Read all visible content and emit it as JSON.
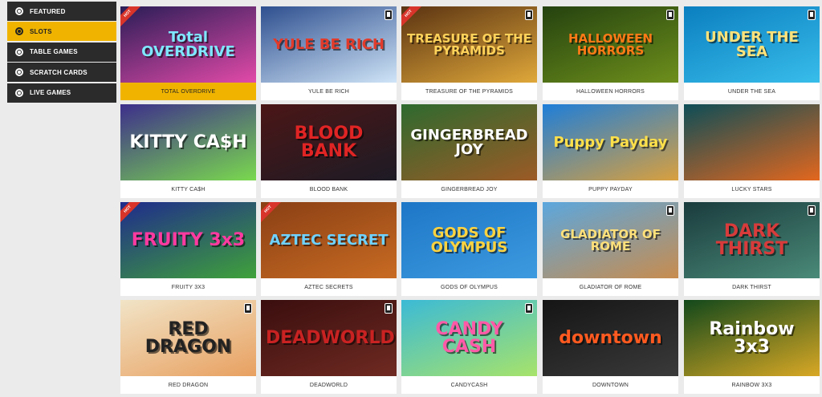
{
  "sidebar": {
    "items": [
      {
        "label": "FEATURED",
        "active": false
      },
      {
        "label": "SLOTS",
        "active": true
      },
      {
        "label": "TABLE GAMES",
        "active": false
      },
      {
        "label": "SCRATCH CARDS",
        "active": false
      },
      {
        "label": "LIVE GAMES",
        "active": false
      }
    ]
  },
  "games": [
    {
      "name": "TOTAL OVERDRIVE",
      "art_text": "Total OVERDRIVE",
      "hot": true,
      "mobile": false,
      "selected": true,
      "bg": [
        "#2a1d57",
        "#e24aa8"
      ],
      "fg": "#7fe7ff"
    },
    {
      "name": "YULE BE RICH",
      "art_text": "YULE BE RICH",
      "hot": false,
      "mobile": true,
      "selected": false,
      "bg": [
        "#2e4f8f",
        "#cfe4f7"
      ],
      "fg": "#e23b2b"
    },
    {
      "name": "TREASURE OF THE PYRAMIDS",
      "art_text": "TREASURE OF THE PYRAMIDS",
      "hot": true,
      "mobile": true,
      "selected": false,
      "bg": [
        "#5a3312",
        "#e0a83a"
      ],
      "fg": "#ffd25a"
    },
    {
      "name": "HALLOWEEN HORRORS",
      "art_text": "HALLOWEEN HORRORS",
      "hot": false,
      "mobile": true,
      "selected": false,
      "bg": [
        "#24420f",
        "#6e8f1c"
      ],
      "fg": "#ff7a16"
    },
    {
      "name": "UNDER THE SEA",
      "art_text": "UNDER THE SEA",
      "hot": false,
      "mobile": true,
      "selected": false,
      "bg": [
        "#0b7fc0",
        "#38bdea"
      ],
      "fg": "#ffe27a"
    },
    {
      "name": "KITTY CA$H",
      "art_text": "KITTY CA$H",
      "hot": false,
      "mobile": false,
      "selected": false,
      "bg": [
        "#3d2e8c",
        "#7ad94e"
      ],
      "fg": "#ffffff"
    },
    {
      "name": "BLOOD BANK",
      "art_text": "BLOOD BANK",
      "hot": false,
      "mobile": false,
      "selected": false,
      "bg": [
        "#4b1616",
        "#1d1b25"
      ],
      "fg": "#e02424"
    },
    {
      "name": "GINGERBREAD JOY",
      "art_text": "GINGERBREAD JOY",
      "hot": false,
      "mobile": false,
      "selected": false,
      "bg": [
        "#2e6a2f",
        "#9c5a26"
      ],
      "fg": "#ffffff"
    },
    {
      "name": "PUPPY PAYDAY",
      "art_text": "Puppy Payday",
      "hot": false,
      "mobile": false,
      "selected": false,
      "bg": [
        "#1e7ed9",
        "#d9a03e"
      ],
      "fg": "#ffe04a"
    },
    {
      "name": "LUCKY STARS",
      "art_text": "",
      "hot": false,
      "mobile": false,
      "selected": false,
      "bg": [
        "#0d4d57",
        "#e3671e"
      ],
      "fg": "#ffffff"
    },
    {
      "name": "FRUITY 3X3",
      "art_text": "FRUITY 3x3",
      "hot": true,
      "mobile": false,
      "selected": false,
      "bg": [
        "#1f2b8c",
        "#3fa23a"
      ],
      "fg": "#ff3aa0"
    },
    {
      "name": "AZTEC SECRETS",
      "art_text": "AZTEC SECRET",
      "hot": true,
      "mobile": false,
      "selected": false,
      "bg": [
        "#8a3f14",
        "#c86b23"
      ],
      "fg": "#6fd2ff"
    },
    {
      "name": "GODS OF OLYMPUS",
      "art_text": "GODS OF OLYMPUS",
      "hot": false,
      "mobile": false,
      "selected": false,
      "bg": [
        "#1e77c7",
        "#3d9adf"
      ],
      "fg": "#ffd33f"
    },
    {
      "name": "GLADIATOR OF ROME",
      "art_text": "GLADIATOR OF ROME",
      "hot": false,
      "mobile": true,
      "selected": false,
      "bg": [
        "#5ba7de",
        "#c88c4e"
      ],
      "fg": "#ffe07a"
    },
    {
      "name": "DARK THIRST",
      "art_text": "DARK THIRST",
      "hot": false,
      "mobile": true,
      "selected": false,
      "bg": [
        "#1a3b3d",
        "#4a8a78"
      ],
      "fg": "#d83b3b"
    },
    {
      "name": "RED DRAGON",
      "art_text": "RED DRAGON",
      "hot": false,
      "mobile": true,
      "selected": false,
      "bg": [
        "#f1e4c7",
        "#e8a060"
      ],
      "fg": "#222222"
    },
    {
      "name": "DEADWORLD",
      "art_text": "DEADWORLD",
      "hot": false,
      "mobile": true,
      "selected": false,
      "bg": [
        "#3a0e0e",
        "#6f2a22"
      ],
      "fg": "#c92222"
    },
    {
      "name": "CANDYCASH",
      "art_text": "CANDY CASH",
      "hot": false,
      "mobile": true,
      "selected": false,
      "bg": [
        "#3bbad6",
        "#a7e36a"
      ],
      "fg": "#ff5aa8"
    },
    {
      "name": "DOWNTOWN",
      "art_text": "downtown",
      "hot": false,
      "mobile": false,
      "selected": false,
      "bg": [
        "#151515",
        "#3a3a3a"
      ],
      "fg": "#ff5a20"
    },
    {
      "name": "RAINBOW 3X3",
      "art_text": "Rainbow 3x3",
      "hot": false,
      "mobile": false,
      "selected": false,
      "bg": [
        "#12481b",
        "#d9a825"
      ],
      "fg": "#ffffff"
    }
  ]
}
